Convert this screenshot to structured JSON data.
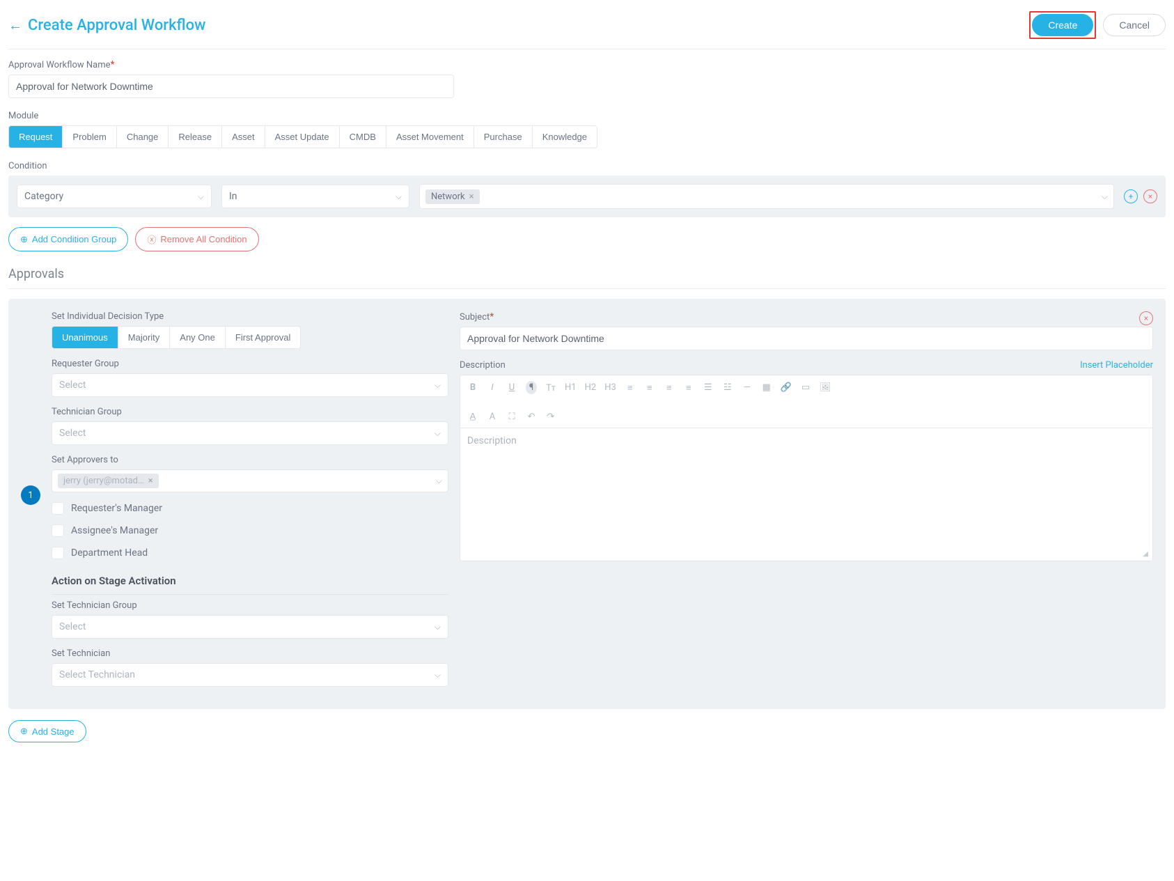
{
  "header": {
    "title": "Create Approval Workflow",
    "create": "Create",
    "cancel": "Cancel"
  },
  "workflow_name": {
    "label": "Approval Workflow Name",
    "value": "Approval for Network Downtime"
  },
  "module": {
    "label": "Module",
    "tabs": [
      "Request",
      "Problem",
      "Change",
      "Release",
      "Asset",
      "Asset Update",
      "CMDB",
      "Asset Movement",
      "Purchase",
      "Knowledge"
    ],
    "active_index": 0
  },
  "condition": {
    "label": "Condition",
    "field": "Category",
    "operator": "In",
    "value_tag": "Network",
    "add_group": "Add Condition Group",
    "remove_all": "Remove All Condition"
  },
  "approvals": {
    "title": "Approvals",
    "stage_number": "1",
    "decision_label": "Set Individual Decision Type",
    "decision_options": [
      "Unanimous",
      "Majority",
      "Any One",
      "First Approval"
    ],
    "decision_active_index": 0,
    "requester_group_label": "Requester Group",
    "technician_group_label": "Technician Group",
    "select_placeholder": "Select",
    "approvers_label": "Set Approvers to",
    "approver_tag": "jerry (jerry@motad…",
    "cb_requester_manager": "Requester's Manager",
    "cb_assignee_manager": "Assignee's Manager",
    "cb_department_head": "Department Head",
    "action_heading": "Action on Stage Activation",
    "set_tech_group_label": "Set Technician Group",
    "set_tech_label": "Set Technician",
    "set_tech_placeholder": "Select Technician",
    "subject_label": "Subject",
    "subject_value": "Approval for Network Downtime",
    "description_label": "Description",
    "insert_placeholder": "Insert Placeholder",
    "description_placeholder": "Description"
  },
  "add_stage": "Add Stage"
}
